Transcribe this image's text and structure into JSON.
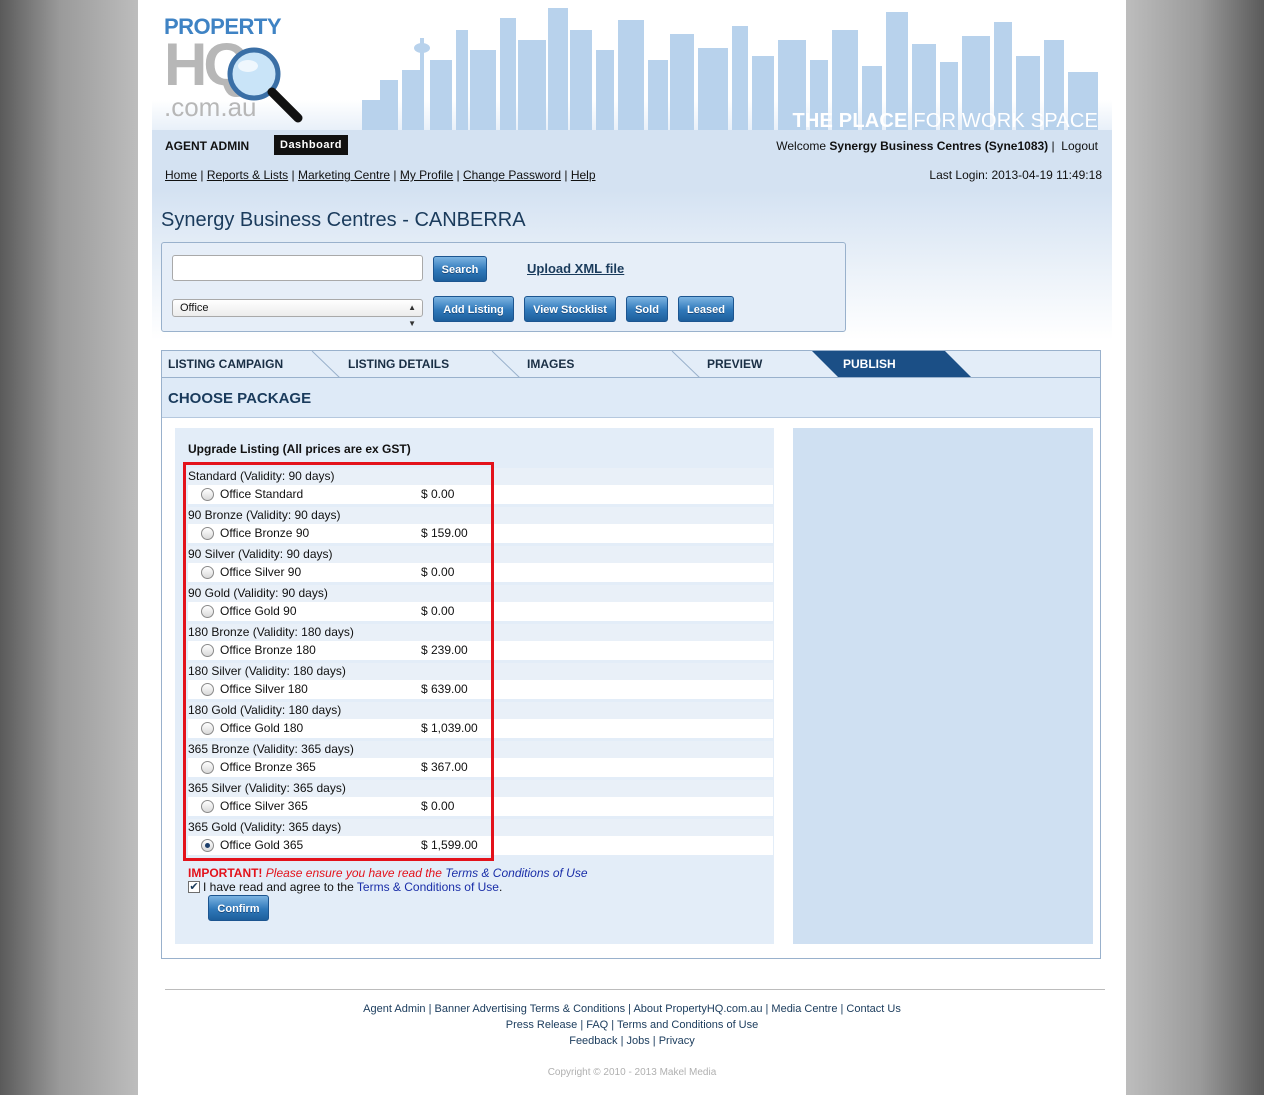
{
  "header": {
    "logo_word": "PROPERTY",
    "logo_hq": "HQ",
    "logo_domain": ".com.au",
    "tagline_bold": "THE PLACE",
    "tagline_rest": " FOR WORK SPACE",
    "agent_admin": "AGENT ADMIN",
    "dashboard": "Dashboard",
    "welcome_prefix": "Welcome ",
    "welcome_user": "Synergy Business Centres (Syne1083)",
    "logout": "Logout",
    "menu": [
      "Home",
      "Reports & Lists",
      "Marketing Centre",
      "My Profile",
      "Change Password",
      "Help"
    ],
    "last_login": "Last Login: 2013-04-19 11:49:18"
  },
  "page_title": "Synergy Business Centres - CANBERRA",
  "search": {
    "value": "",
    "search_btn": "Search",
    "upload_xml": "Upload XML file",
    "type_selected": "Office",
    "add_listing": "Add Listing",
    "view_stocklist": "View Stocklist",
    "sold": "Sold",
    "leased": "Leased"
  },
  "tabs": [
    "LISTING CAMPAIGN",
    "LISTING DETAILS",
    "IMAGES",
    "PREVIEW",
    "PUBLISH"
  ],
  "active_tab": "PUBLISH",
  "section_title": "CHOOSE PACKAGE",
  "upgrade_title": "Upgrade Listing (All prices are ex GST)",
  "packages": [
    {
      "heading": "Standard (Validity: 90 days)",
      "name": "Office Standard",
      "price": "$ 0.00",
      "selected": false
    },
    {
      "heading": "90 Bronze (Validity: 90 days)",
      "name": "Office Bronze 90",
      "price": "$ 159.00",
      "selected": false
    },
    {
      "heading": "90 Silver (Validity: 90 days)",
      "name": "Office Silver 90",
      "price": "$ 0.00",
      "selected": false
    },
    {
      "heading": "90 Gold (Validity: 90 days)",
      "name": "Office Gold 90",
      "price": "$ 0.00",
      "selected": false
    },
    {
      "heading": "180 Bronze (Validity: 180 days)",
      "name": "Office Bronze 180",
      "price": "$ 239.00",
      "selected": false
    },
    {
      "heading": "180 Silver (Validity: 180 days)",
      "name": "Office Silver 180",
      "price": "$ 639.00",
      "selected": false
    },
    {
      "heading": "180 Gold (Validity: 180 days)",
      "name": "Office Gold 180",
      "price": "$ 1,039.00",
      "selected": false
    },
    {
      "heading": "365 Bronze (Validity: 365 days)",
      "name": "Office Bronze 365",
      "price": "$ 367.00",
      "selected": false
    },
    {
      "heading": "365 Silver (Validity: 365 days)",
      "name": "Office Silver 365",
      "price": "$ 0.00",
      "selected": false
    },
    {
      "heading": "365 Gold (Validity: 365 days)",
      "name": "Office Gold 365",
      "price": "$ 1,599.00",
      "selected": true
    }
  ],
  "important": {
    "label": "IMPORTANT!",
    "warning": " Please ensure you have read the ",
    "link": "Terms & Conditions of Use"
  },
  "agree": {
    "checked": true,
    "text": "I have read and agree to the ",
    "link": "Terms & Conditions of Use",
    "suffix": "."
  },
  "confirm": "Confirm",
  "footer": {
    "line1": "Agent Admin | Banner Advertising Terms & Conditions | About PropertyHQ.com.au | Media Centre | Contact Us",
    "line2": "Press Release | FAQ | Terms and Conditions of Use",
    "line3": "Feedback | Jobs | Privacy",
    "copyright": "Copyright © 2010 - 2013 Makel Media"
  },
  "colors": {
    "highlight": "#e3121b",
    "button": "#2f78b9",
    "publish_tab": "#1b4f86"
  }
}
